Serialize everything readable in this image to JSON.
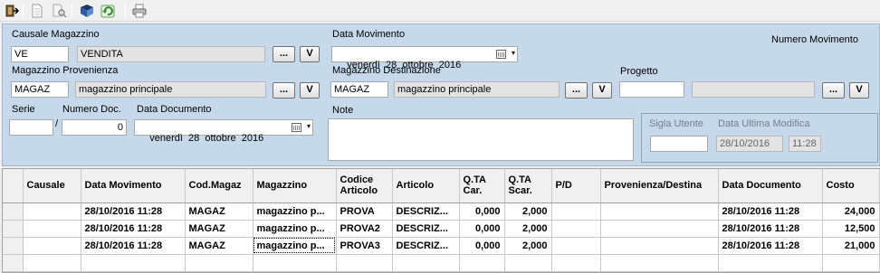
{
  "toolbar": {
    "items": [
      {
        "name": "exit-icon"
      },
      {
        "name": "new-document-icon"
      },
      {
        "name": "find-replace-icon"
      },
      {
        "name": "book-icon"
      },
      {
        "name": "refresh-icon"
      },
      {
        "name": "print-icon"
      }
    ]
  },
  "form": {
    "causale_label": "Causale Magazzino",
    "causale_code": "VE",
    "causale_desc": "VENDITA",
    "data_movimento_label": "Data Movimento",
    "data_movimento": "venerdì  28  ottobre  2016",
    "numero_movimento_label": "Numero Movimento",
    "mag_prov_label": "Magazzino Provenienza",
    "mag_prov_code": "MAGAZ",
    "mag_prov_desc": "magazzino principale",
    "mag_dest_label": "Magazzino Destinazione",
    "mag_dest_code": "MAGAZ",
    "mag_dest_desc": "magazzino principale",
    "progetto_label": "Progetto",
    "progetto_code": "",
    "progetto_desc": "",
    "serie_label": "Serie",
    "serie_value": "",
    "slash": "/",
    "numero_doc_label": "Numero Doc.",
    "numero_doc_value": "0",
    "data_doc_label": "Data Documento",
    "data_doc": "venerdì  28  ottobre  2016",
    "note_label": "Note",
    "note_value": "",
    "sigla_label": "Sigla Utente",
    "sigla_value": "",
    "ultima_mod_label": "Data Ultima Modifica",
    "ultima_mod_date": "28/10/2016",
    "ultima_mod_time": "11:28",
    "ellipsis": "...",
    "v": "V"
  },
  "grid": {
    "columns": [
      "Causale",
      "Data Movimento",
      "Cod.Magaz",
      "Magazzino",
      "Codice Articolo",
      "Articolo",
      "Q.TA Car.",
      "Q.TA Scar.",
      "P/D",
      "Provenienza/Destina",
      "Data Documento",
      "Costo"
    ],
    "rows": [
      [
        "",
        "28/10/2016 11:28",
        "MAGAZ",
        "magazzino p...",
        "PROVA",
        "DESCRIZ...",
        "0,000",
        "2,000",
        "",
        "",
        "28/10/2016 11:28",
        "24,000"
      ],
      [
        "",
        "28/10/2016 11:28",
        "MAGAZ",
        "magazzino p...",
        "PROVA2",
        "DESCRIZ...",
        "0,000",
        "2,000",
        "",
        "",
        "28/10/2016 11:28",
        "12,500"
      ],
      [
        "",
        "28/10/2016 11:28",
        "MAGAZ",
        "magazzino p...",
        "PROVA3",
        "DESCRIZ...",
        "0,000",
        "2,000",
        "",
        "",
        "28/10/2016 11:28",
        "21,000"
      ]
    ]
  }
}
